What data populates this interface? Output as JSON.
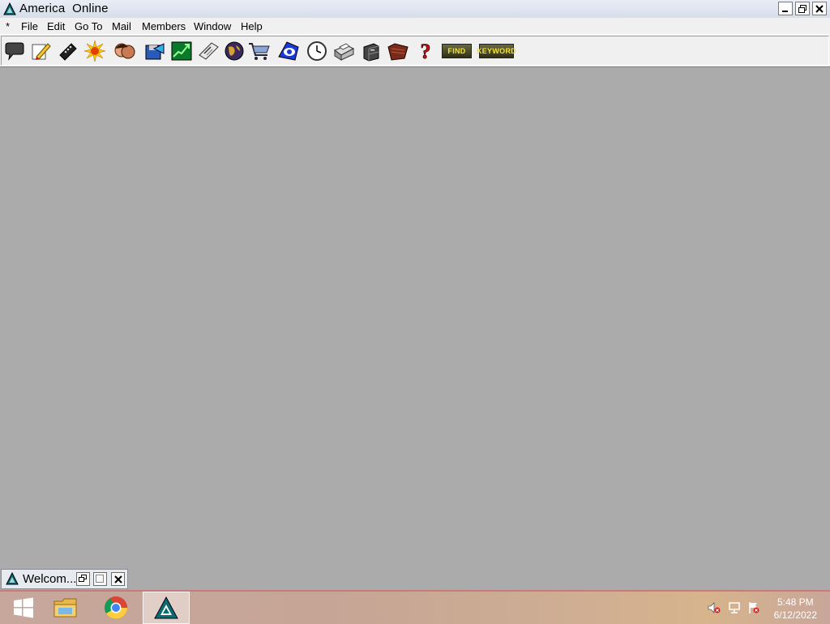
{
  "window": {
    "title": "America  Online"
  },
  "menu": [
    "*",
    "File",
    "Edit",
    "Go To",
    "Mail",
    "Members",
    "Window",
    "Help"
  ],
  "toolbar": {
    "icons": [
      "message-icon",
      "write-icon",
      "remote-icon",
      "whats-hot-icon",
      "people-icon",
      "download-icon",
      "stocks-icon",
      "news-icon",
      "globe-icon",
      "shopping-cart-icon",
      "internet-icon",
      "clock-icon",
      "print-icon",
      "filing-cabinet-icon",
      "favorites-icon",
      "help-icon"
    ],
    "find_label": "FIND",
    "keyword_label": "KEYWORD"
  },
  "minimized_window": {
    "title": "Welcom..."
  },
  "taskbar": {
    "apps": [
      "start-icon",
      "file-explorer-icon",
      "chrome-icon",
      "aol-icon"
    ],
    "time": "5:48 PM",
    "date": "6/12/2022"
  }
}
